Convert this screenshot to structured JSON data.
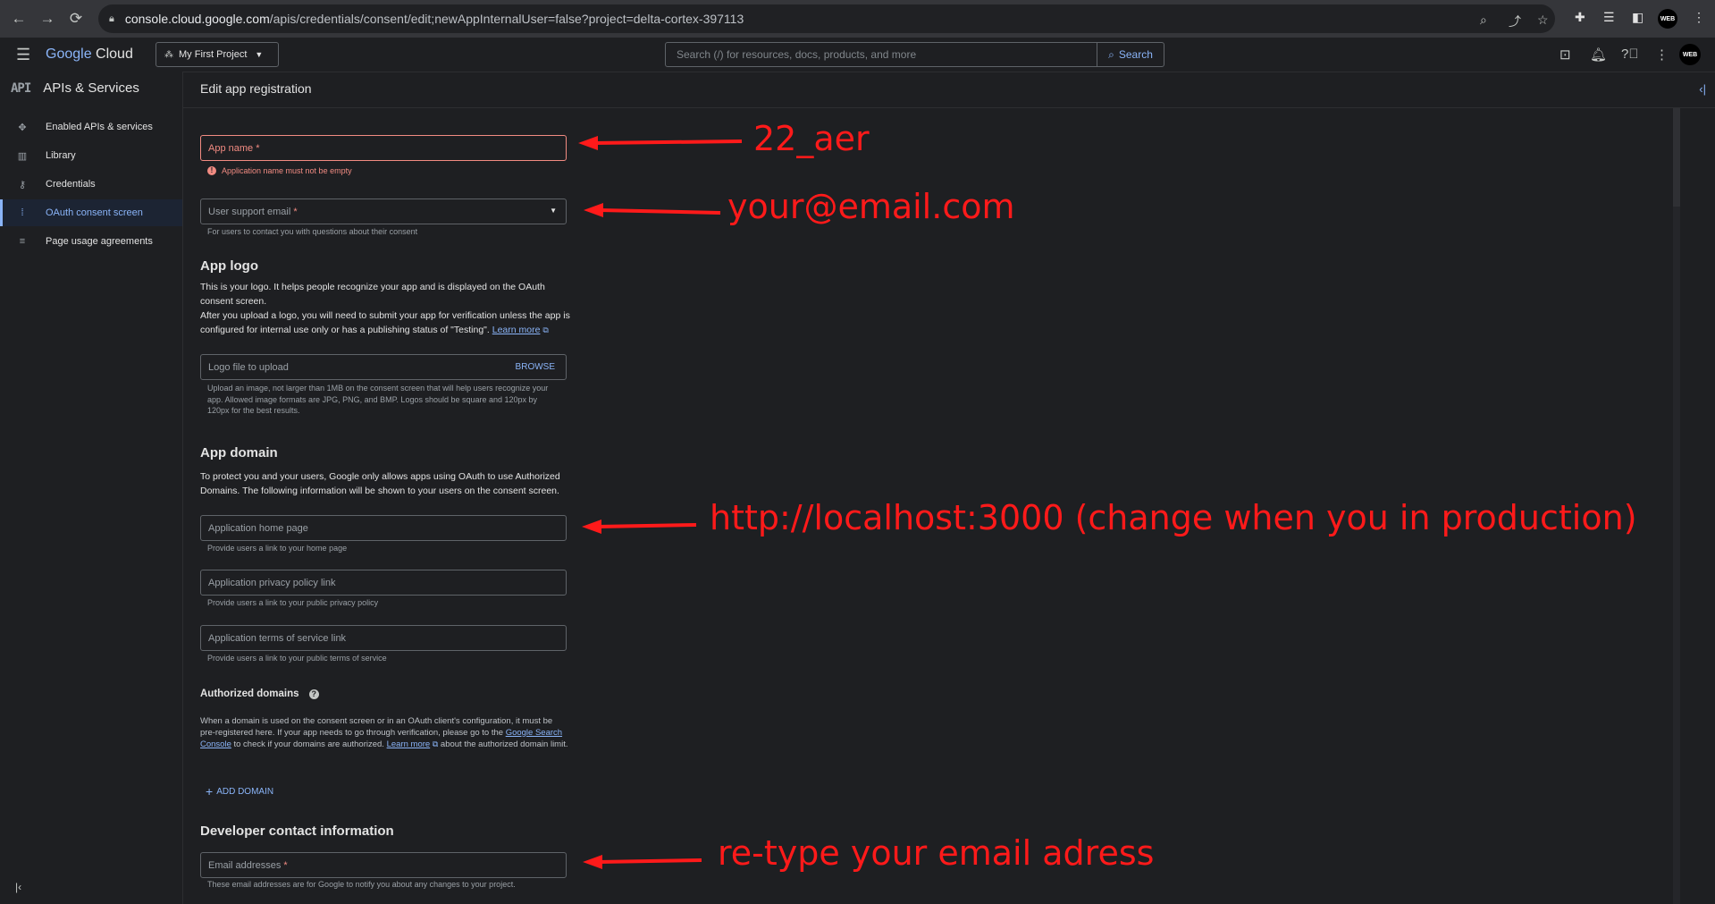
{
  "browser": {
    "url_host": "console.cloud.google.com",
    "url_path": "/apis/credentials/consent/edit;newAppInternalUser=false?project=delta-cortex-397113",
    "avatar_label": "WEB"
  },
  "header": {
    "logo_google": "Google",
    "logo_cloud": "Cloud",
    "project": "My First Project",
    "search_placeholder": "Search (/) for resources, docs, products, and more",
    "search_button": "Search",
    "avatar_label": "WEB"
  },
  "sidebar": {
    "title": "APIs & Services",
    "api_badge": "API",
    "items": [
      {
        "label": "Enabled APIs & services",
        "icon": "diamond-icon"
      },
      {
        "label": "Library",
        "icon": "library-icon"
      },
      {
        "label": "Credentials",
        "icon": "key-icon"
      },
      {
        "label": "OAuth consent screen",
        "icon": "consent-icon",
        "active": true
      },
      {
        "label": "Page usage agreements",
        "icon": "settings-list-icon"
      }
    ]
  },
  "page": {
    "title": "Edit app registration",
    "app_name": {
      "placeholder": "App name",
      "required": "*",
      "error": "Application name must not be empty"
    },
    "support_email": {
      "placeholder": "User support email",
      "required": "*",
      "hint": "For users to contact you with questions about their consent"
    },
    "app_logo": {
      "title": "App logo",
      "desc1": "This is your logo. It helps people recognize your app and is displayed on the OAuth consent screen.",
      "desc2": "After you upload a logo, you will need to submit your app for verification unless the app is configured for internal use only or has a publishing status of \"Testing\".",
      "learn_more": "Learn more",
      "file_placeholder": "Logo file to upload",
      "browse": "BROWSE",
      "hint": "Upload an image, not larger than 1MB on the consent screen that will help users recognize your app. Allowed image formats are JPG, PNG, and BMP. Logos should be square and 120px by 120px for the best results."
    },
    "app_domain": {
      "title": "App domain",
      "desc": "To protect you and your users, Google only allows apps using OAuth to use Authorized Domains. The following information will be shown to your users on the consent screen.",
      "home_placeholder": "Application home page",
      "home_hint": "Provide users a link to your home page",
      "privacy_placeholder": "Application privacy policy link",
      "privacy_hint": "Provide users a link to your public privacy policy",
      "terms_placeholder": "Application terms of service link",
      "terms_hint": "Provide users a link to your public terms of service"
    },
    "authorized_domains": {
      "title": "Authorized domains",
      "desc_a": "When a domain is used on the consent screen or in an OAuth client's configuration, it must be pre-registered here. If your app needs to go through verification, please go to the",
      "link1": "Google Search Console",
      "desc_b": "to check if your domains are authorized.",
      "link2": "Learn more",
      "desc_c": "about the authorized domain limit.",
      "add_button": "ADD DOMAIN"
    },
    "developer_contact": {
      "title": "Developer contact information",
      "email_placeholder": "Email addresses",
      "required": "*",
      "hint": "These email addresses are for Google to notify you about any changes to your project."
    }
  },
  "annotations": {
    "app_name": "22_aer",
    "email": "your@email.com",
    "home_page": "http://localhost:3000 (change when you in production)",
    "dev_email": "re-type your email adress",
    "color": "#ff1a1a"
  }
}
